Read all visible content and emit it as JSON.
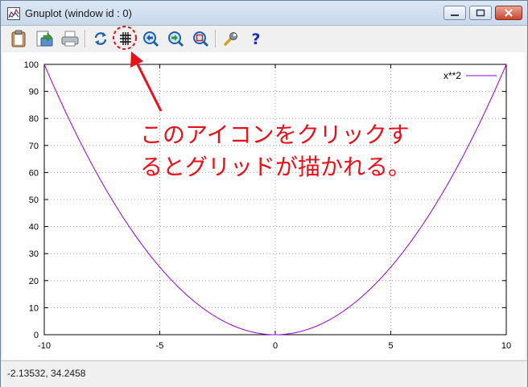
{
  "window": {
    "title": "Gnuplot (window id : 0)"
  },
  "toolbar": {
    "buttons": [
      {
        "icon": "clipboard-icon",
        "label": "Copy to clipboard"
      },
      {
        "icon": "export-icon",
        "label": "Export"
      },
      {
        "icon": "print-icon",
        "label": "Print"
      },
      {
        "icon": "replot-icon",
        "label": "Replot"
      },
      {
        "icon": "grid-icon",
        "label": "Toggle grid"
      },
      {
        "icon": "zoom-previous-icon",
        "label": "Previous zoom"
      },
      {
        "icon": "zoom-next-icon",
        "label": "Next zoom"
      },
      {
        "icon": "autoscale-icon",
        "label": "Autoscale"
      },
      {
        "icon": "options-icon",
        "label": "Options"
      },
      {
        "icon": "help-icon",
        "label": "Help"
      }
    ]
  },
  "annotation": {
    "line1": "このアイコンをクリックす",
    "line2": "るとグリッドが描かれる。",
    "color": "#e8101a"
  },
  "status": {
    "coordinates": "-2.13532,  34.2458"
  },
  "chart_data": {
    "type": "line",
    "function": "x**2",
    "series": [
      {
        "name": "x**2",
        "color": "#9400d3",
        "x": [
          -10,
          -9,
          -8,
          -7,
          -6,
          -5,
          -4,
          -3,
          -2,
          -1,
          0,
          1,
          2,
          3,
          4,
          5,
          6,
          7,
          8,
          9,
          10
        ],
        "values": [
          100,
          81,
          64,
          49,
          36,
          25,
          16,
          9,
          4,
          1,
          0,
          1,
          4,
          9,
          16,
          25,
          36,
          49,
          64,
          81,
          100
        ]
      }
    ],
    "xlim": [
      -10,
      10
    ],
    "ylim": [
      0,
      100
    ],
    "x_ticks": [
      "-10",
      "-5",
      "0",
      "5",
      "10"
    ],
    "x_tick_values": [
      -10,
      -5,
      0,
      5,
      10
    ],
    "y_ticks": [
      "0",
      "10",
      "20",
      "30",
      "40",
      "50",
      "60",
      "70",
      "80",
      "90",
      "100"
    ],
    "y_tick_values": [
      0,
      10,
      20,
      30,
      40,
      50,
      60,
      70,
      80,
      90,
      100
    ],
    "grid": true,
    "legend_position": "top-right",
    "title": "",
    "xlabel": "",
    "ylabel": ""
  }
}
